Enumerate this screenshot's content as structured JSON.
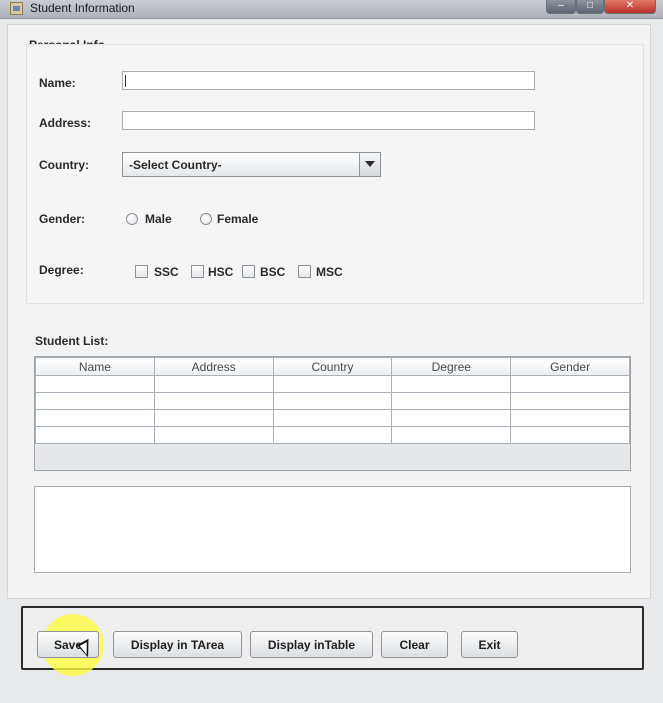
{
  "window": {
    "title": "Student Information"
  },
  "personal": {
    "group_title": "Personal Info",
    "name_label": "Name:",
    "name_value": "",
    "address_label": "Address:",
    "address_value": "",
    "country_label": "Country:",
    "country_selected": "-Select Country-",
    "gender_label": "Gender:",
    "gender_options": [
      "Male",
      "Female"
    ],
    "degree_label": "Degree:",
    "degree_options": [
      "SSC",
      "HSC",
      "BSC",
      "MSC"
    ]
  },
  "student_list": {
    "label": "Student List:",
    "columns": [
      "Name",
      "Address",
      "Country",
      "Degree",
      "Gender"
    ]
  },
  "text_area": {
    "value": ""
  },
  "buttons": {
    "save": "Save",
    "display_tarea": "Display in TArea",
    "display_table": "Display inTable",
    "clear": "Clear",
    "exit": "Exit"
  }
}
